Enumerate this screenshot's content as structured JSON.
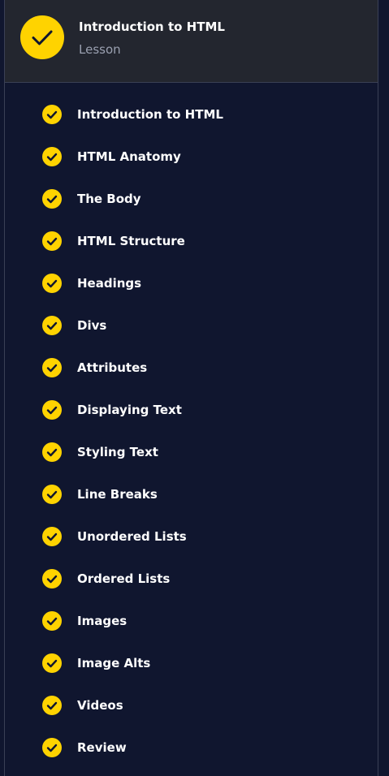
{
  "colors": {
    "background": "#10162f",
    "header_background": "#23262f",
    "accent": "#ffd300",
    "text": "#ffffff",
    "muted_text": "#9aa0b0"
  },
  "header": {
    "title": "Introduction to HTML",
    "subtitle": "Lesson",
    "status_icon": "check-circle-icon"
  },
  "items": [
    {
      "label": "Introduction to HTML",
      "icon": "check-circle-icon",
      "completed": true
    },
    {
      "label": "HTML Anatomy",
      "icon": "check-circle-icon",
      "completed": true
    },
    {
      "label": "The Body",
      "icon": "check-circle-icon",
      "completed": true
    },
    {
      "label": "HTML Structure",
      "icon": "check-circle-icon",
      "completed": true
    },
    {
      "label": "Headings",
      "icon": "check-circle-icon",
      "completed": true
    },
    {
      "label": "Divs",
      "icon": "check-circle-icon",
      "completed": true
    },
    {
      "label": "Attributes",
      "icon": "check-circle-icon",
      "completed": true
    },
    {
      "label": "Displaying Text",
      "icon": "check-circle-icon",
      "completed": true
    },
    {
      "label": "Styling Text",
      "icon": "check-circle-icon",
      "completed": true
    },
    {
      "label": "Line Breaks",
      "icon": "check-circle-icon",
      "completed": true
    },
    {
      "label": "Unordered Lists",
      "icon": "check-circle-icon",
      "completed": true
    },
    {
      "label": "Ordered Lists",
      "icon": "check-circle-icon",
      "completed": true
    },
    {
      "label": "Images",
      "icon": "check-circle-icon",
      "completed": true
    },
    {
      "label": "Image Alts",
      "icon": "check-circle-icon",
      "completed": true
    },
    {
      "label": "Videos",
      "icon": "check-circle-icon",
      "completed": true
    },
    {
      "label": "Review",
      "icon": "check-circle-icon",
      "completed": true
    }
  ]
}
